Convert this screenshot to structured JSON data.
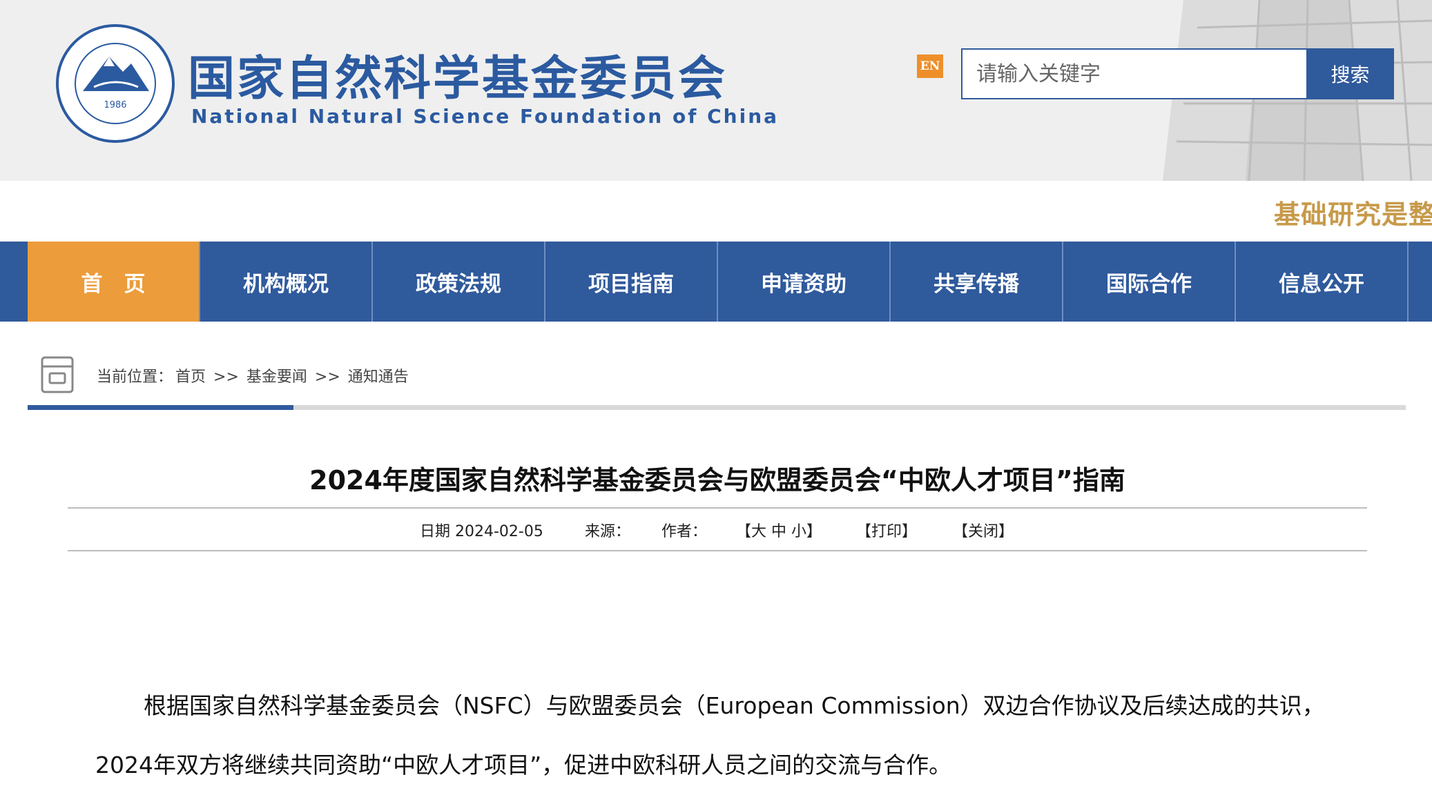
{
  "header": {
    "title_cn": "国家自然科学基金委员会",
    "title_en": "National Natural Science Foundation of China",
    "logo_year": "1986",
    "en_label": "EN",
    "search_placeholder": "请输入关键字",
    "search_button": "搜索",
    "slogan": "基础研究是整"
  },
  "nav": [
    {
      "label": "首　页",
      "active": true
    },
    {
      "label": "机构概况"
    },
    {
      "label": "政策法规"
    },
    {
      "label": "项目指南"
    },
    {
      "label": "申请资助"
    },
    {
      "label": "共享传播"
    },
    {
      "label": "国际合作"
    },
    {
      "label": "信息公开"
    }
  ],
  "breadcrumb": {
    "prefix": "当前位置：",
    "items": [
      "首页",
      "基金要闻",
      "通知通告"
    ],
    "separator": ">>"
  },
  "article": {
    "title": "2024年度国家自然科学基金委员会与欧盟委员会“中欧人才项目”指南",
    "date": "日期 2024-02-05",
    "source_label": "来源：",
    "author_label": "作者：",
    "font_size_controls": "【大 中 小】",
    "print": "【打印】",
    "close": "【关闭】",
    "paragraph": "根据国家自然科学基金委员会（NSFC）与欧盟委员会（European Commission）双边合作协议及后续达成的共识，2024年双方将继续共同资助“中欧人才项目”，促进中欧科研人员之间的交流与合作。"
  },
  "colors": {
    "brand_blue": "#2f5a9c",
    "active_orange": "#ec9c3a",
    "slogan_gold": "#c79a4b",
    "en_orange": "#ee8f2a"
  }
}
